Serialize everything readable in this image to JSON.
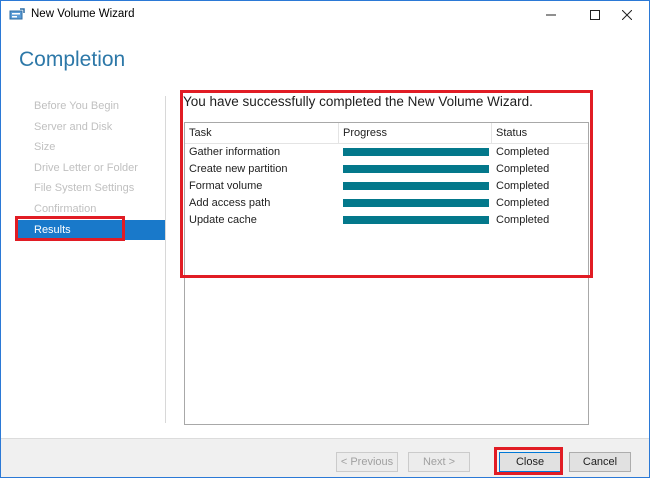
{
  "window": {
    "title": "New Volume Wizard"
  },
  "heading": "Completion",
  "nav": {
    "items": [
      {
        "label": "Before You Begin"
      },
      {
        "label": "Server and Disk"
      },
      {
        "label": "Size"
      },
      {
        "label": "Drive Letter or Folder"
      },
      {
        "label": "File System Settings"
      },
      {
        "label": "Confirmation"
      },
      {
        "label": "Results"
      }
    ],
    "active_index": 6
  },
  "results": {
    "message": "You have successfully completed the New Volume Wizard.",
    "columns": {
      "task": "Task",
      "progress": "Progress",
      "status": "Status"
    },
    "rows": [
      {
        "task": "Gather information",
        "progress": 1.0,
        "status": "Completed"
      },
      {
        "task": "Create new partition",
        "progress": 1.0,
        "status": "Completed"
      },
      {
        "task": "Format volume",
        "progress": 1.0,
        "status": "Completed"
      },
      {
        "task": "Add access path",
        "progress": 1.0,
        "status": "Completed"
      },
      {
        "task": "Update cache",
        "progress": 1.0,
        "status": "Completed"
      }
    ]
  },
  "footer": {
    "previous_label": "< Previous",
    "next_label": "Next >",
    "close_label": "Close",
    "cancel_label": "Cancel"
  },
  "colors": {
    "accent": "#1979ca",
    "heading": "#2d78a8",
    "progress_fill": "#03788b",
    "highlight": "#e11c24"
  },
  "icons": {
    "app": "volume-wizard-icon",
    "minimize": "minimize-icon",
    "maximize": "maximize-icon",
    "close": "close-icon"
  }
}
